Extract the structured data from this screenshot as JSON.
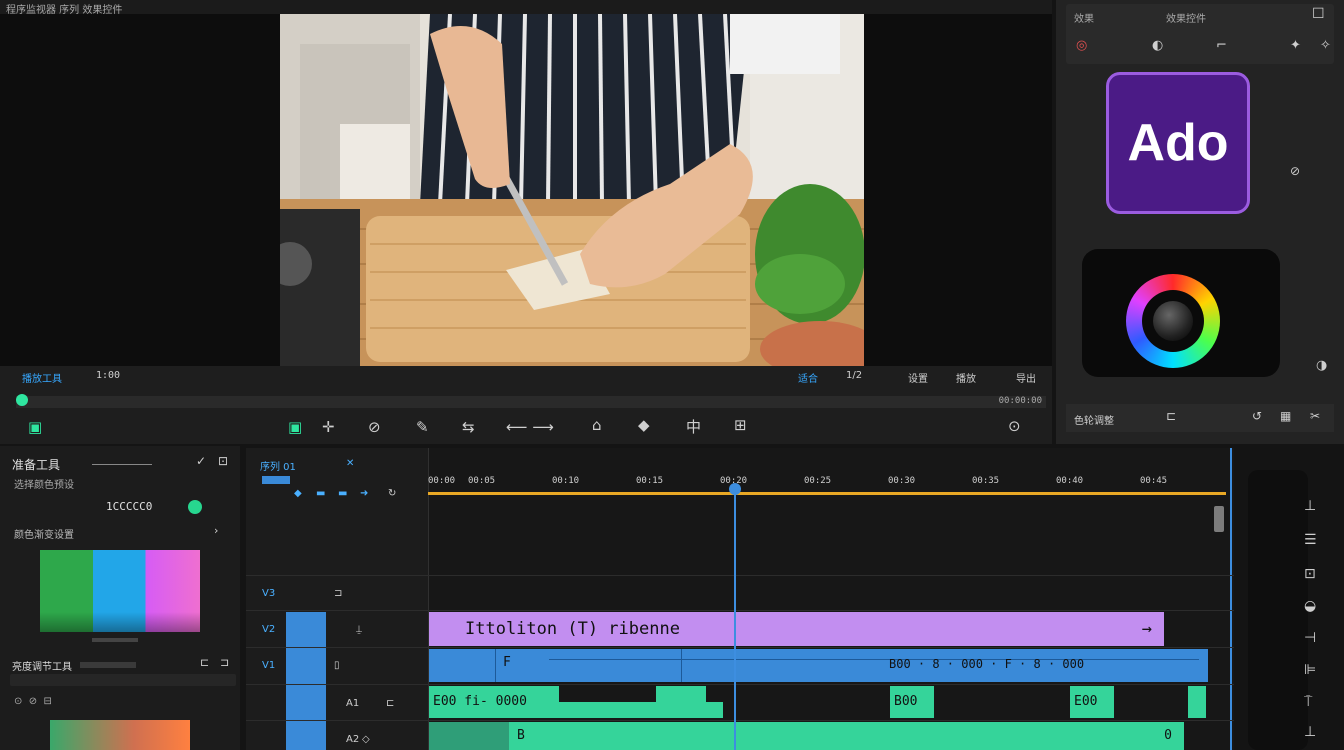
{
  "top_bar": {
    "menu_text": "程序监视器 序列 效果控件"
  },
  "monitor": {
    "left_label": "播放工具",
    "timecode": "1:00",
    "right_labels": [
      "适合",
      "1/2",
      "设置",
      "播放",
      "导出"
    ],
    "scrub_label": "00:00:00"
  },
  "effects_panel": {
    "title_left": "效果",
    "title_mid": "效果控件",
    "app_logo_text": "Ado",
    "footer_label": "色轮调整"
  },
  "color_panel": {
    "title": "准备工具",
    "subtitle": "选择颜色预设",
    "hex_value": "1CCCCC0",
    "section_label": "颜色渐变设置",
    "section2_label": "亮度调节工具"
  },
  "timeline": {
    "sequence_name": "序列 01",
    "ruler_marks": [
      "00:00",
      "00:05",
      "00:10",
      "00:15",
      "00:20",
      "00:25",
      "00:30",
      "00:35",
      "00:40",
      "00:45"
    ],
    "tracks": [
      "V3",
      "V2",
      "V1",
      "A1",
      "A2"
    ],
    "title_clip": "Ittoliton (T) ribenne",
    "video_clip_label": "F",
    "video_clip_tail": "B00 · 8 · 000 · F · 8 · 000",
    "audio_clip1": "E00 fi- 0000",
    "audio_clip2": "B00",
    "audio_clip3": "E00",
    "audio_clip6": "B",
    "audio_clip6_end": "0"
  },
  "colors": {
    "accent": "#3d8ee0",
    "title_clip": "#c28ef0",
    "video_clip": "#3a8ad8",
    "audio_clip": "#35d49a",
    "ruler": "#e9a825"
  }
}
